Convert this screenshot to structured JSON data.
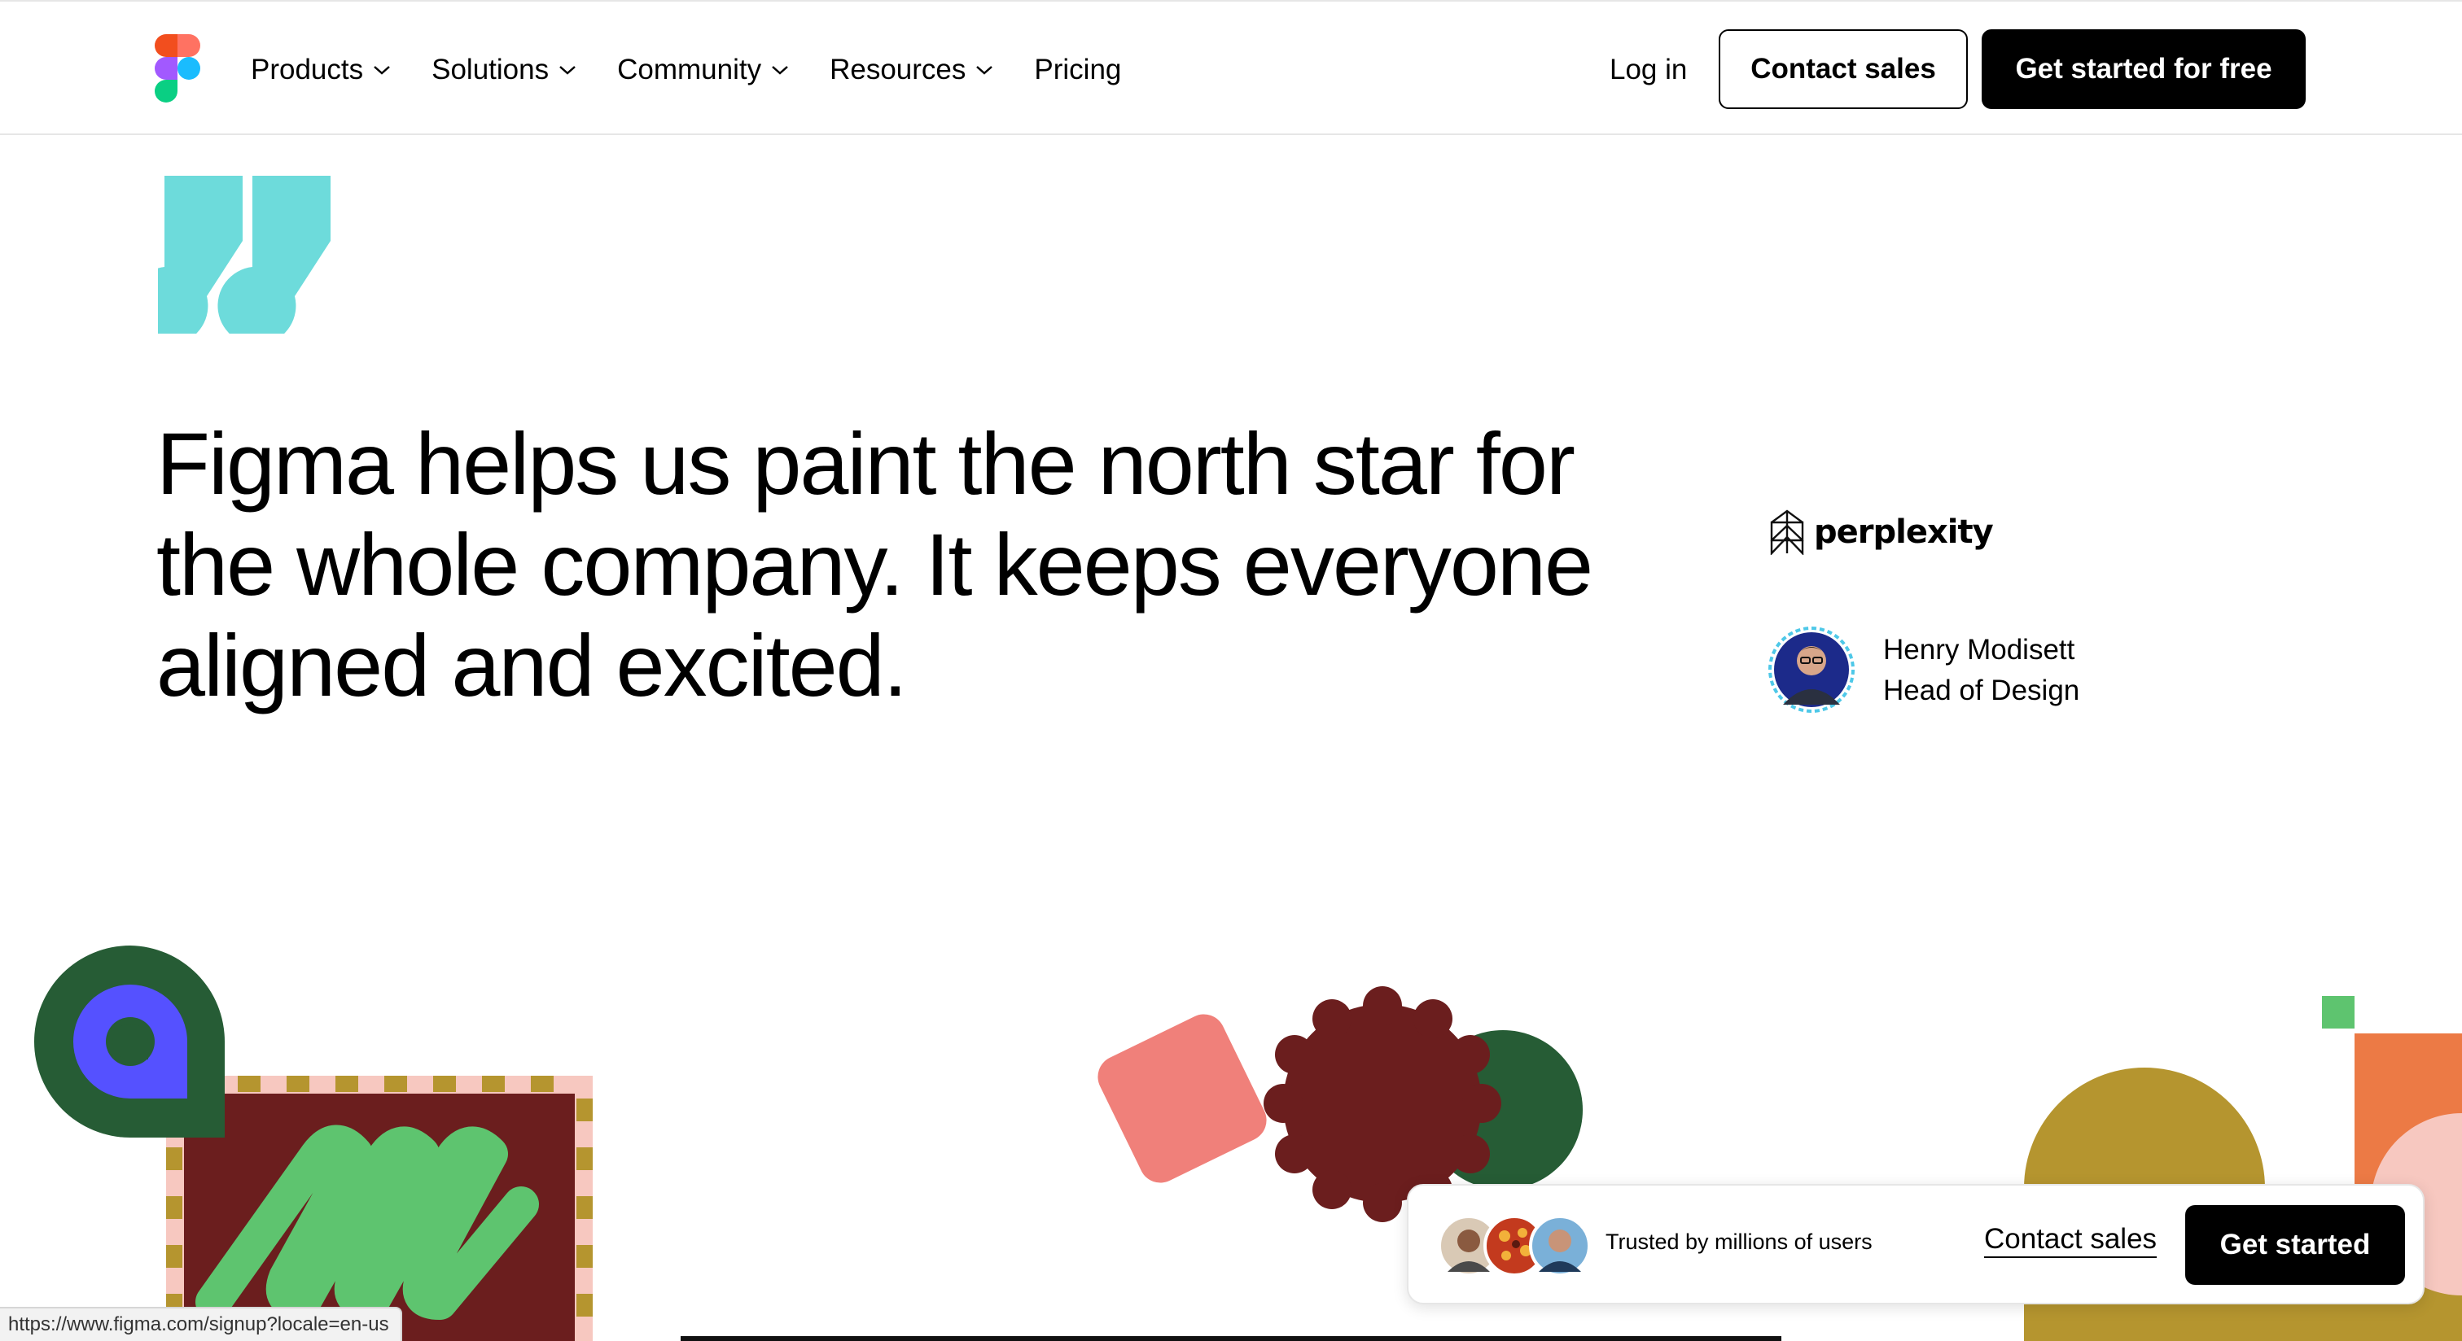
{
  "nav": {
    "items": [
      {
        "label": "Products",
        "has_dropdown": true
      },
      {
        "label": "Solutions",
        "has_dropdown": true
      },
      {
        "label": "Community",
        "has_dropdown": true
      },
      {
        "label": "Resources",
        "has_dropdown": true
      },
      {
        "label": "Pricing",
        "has_dropdown": false
      }
    ],
    "login_label": "Log in",
    "contact_sales_label": "Contact sales",
    "get_started_label": "Get started for free"
  },
  "testimonial": {
    "quote": "Figma helps us paint the north star for the whole company. It keeps everyone aligned and excited.",
    "company": "perplexity",
    "author_name": "Henry Modisett",
    "author_role": "Head of Design"
  },
  "banner": {
    "trust_text": "Trusted by millions of users",
    "contact_label": "Contact sales",
    "cta_label": "Get started"
  },
  "status_bar": {
    "url": "https://www.figma.com/signup?locale=en-us"
  },
  "colors": {
    "quote_mark": "#6ddbdb",
    "pin_outer": "#265c35",
    "pin_inner": "#5551ff",
    "green": "#5ec46f",
    "maroon": "#6b1e1e",
    "mustard": "#b5952f",
    "pink": "#f0807a",
    "light_pink": "#f7c8c0",
    "orange": "#ec7a45"
  },
  "icons": [
    "figma-logo-icon",
    "chevron-down-icon",
    "quote-icon",
    "perplexity-logo-icon",
    "avatar"
  ]
}
